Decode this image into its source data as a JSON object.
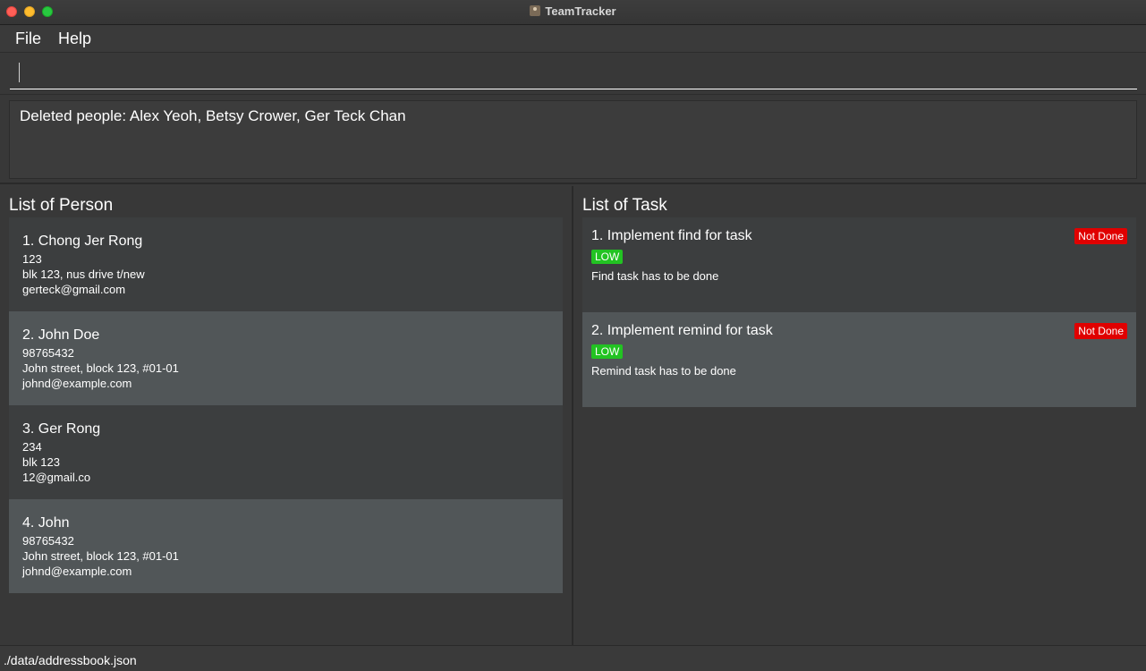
{
  "window": {
    "title": "TeamTracker"
  },
  "menu": {
    "file": "File",
    "help": "Help"
  },
  "command": {
    "value": "",
    "placeholder": ""
  },
  "result": {
    "text": "Deleted people: Alex Yeoh, Betsy Crower, Ger Teck Chan"
  },
  "persons": {
    "title": "List of Person",
    "items": [
      {
        "name": "1.  Chong Jer Rong",
        "phone": "123",
        "address": "blk 123, nus drive t/new",
        "email": "gerteck@gmail.com"
      },
      {
        "name": "2.  John Doe",
        "phone": "98765432",
        "address": "John street, block 123, #01-01",
        "email": "johnd@example.com"
      },
      {
        "name": "3.  Ger Rong",
        "phone": "234",
        "address": "blk 123",
        "email": "12@gmail.co"
      },
      {
        "name": "4.  John",
        "phone": "98765432",
        "address": "John street, block 123, #01-01",
        "email": "johnd@example.com"
      }
    ]
  },
  "tasks": {
    "title": "List of Task",
    "items": [
      {
        "title": "1. Implement find for task",
        "status": "Not Done",
        "priority": "LOW",
        "description": "Find task has to be done"
      },
      {
        "title": "2. Implement remind for task",
        "status": "Not Done",
        "priority": "LOW",
        "description": "Remind task has to be done"
      }
    ]
  },
  "statusbar": {
    "path": "./data/addressbook.json"
  },
  "colors": {
    "status_not_done": "#e00000",
    "priority_low": "#22c322",
    "card_dark": "#3c3e3f",
    "card_light": "#515658"
  }
}
